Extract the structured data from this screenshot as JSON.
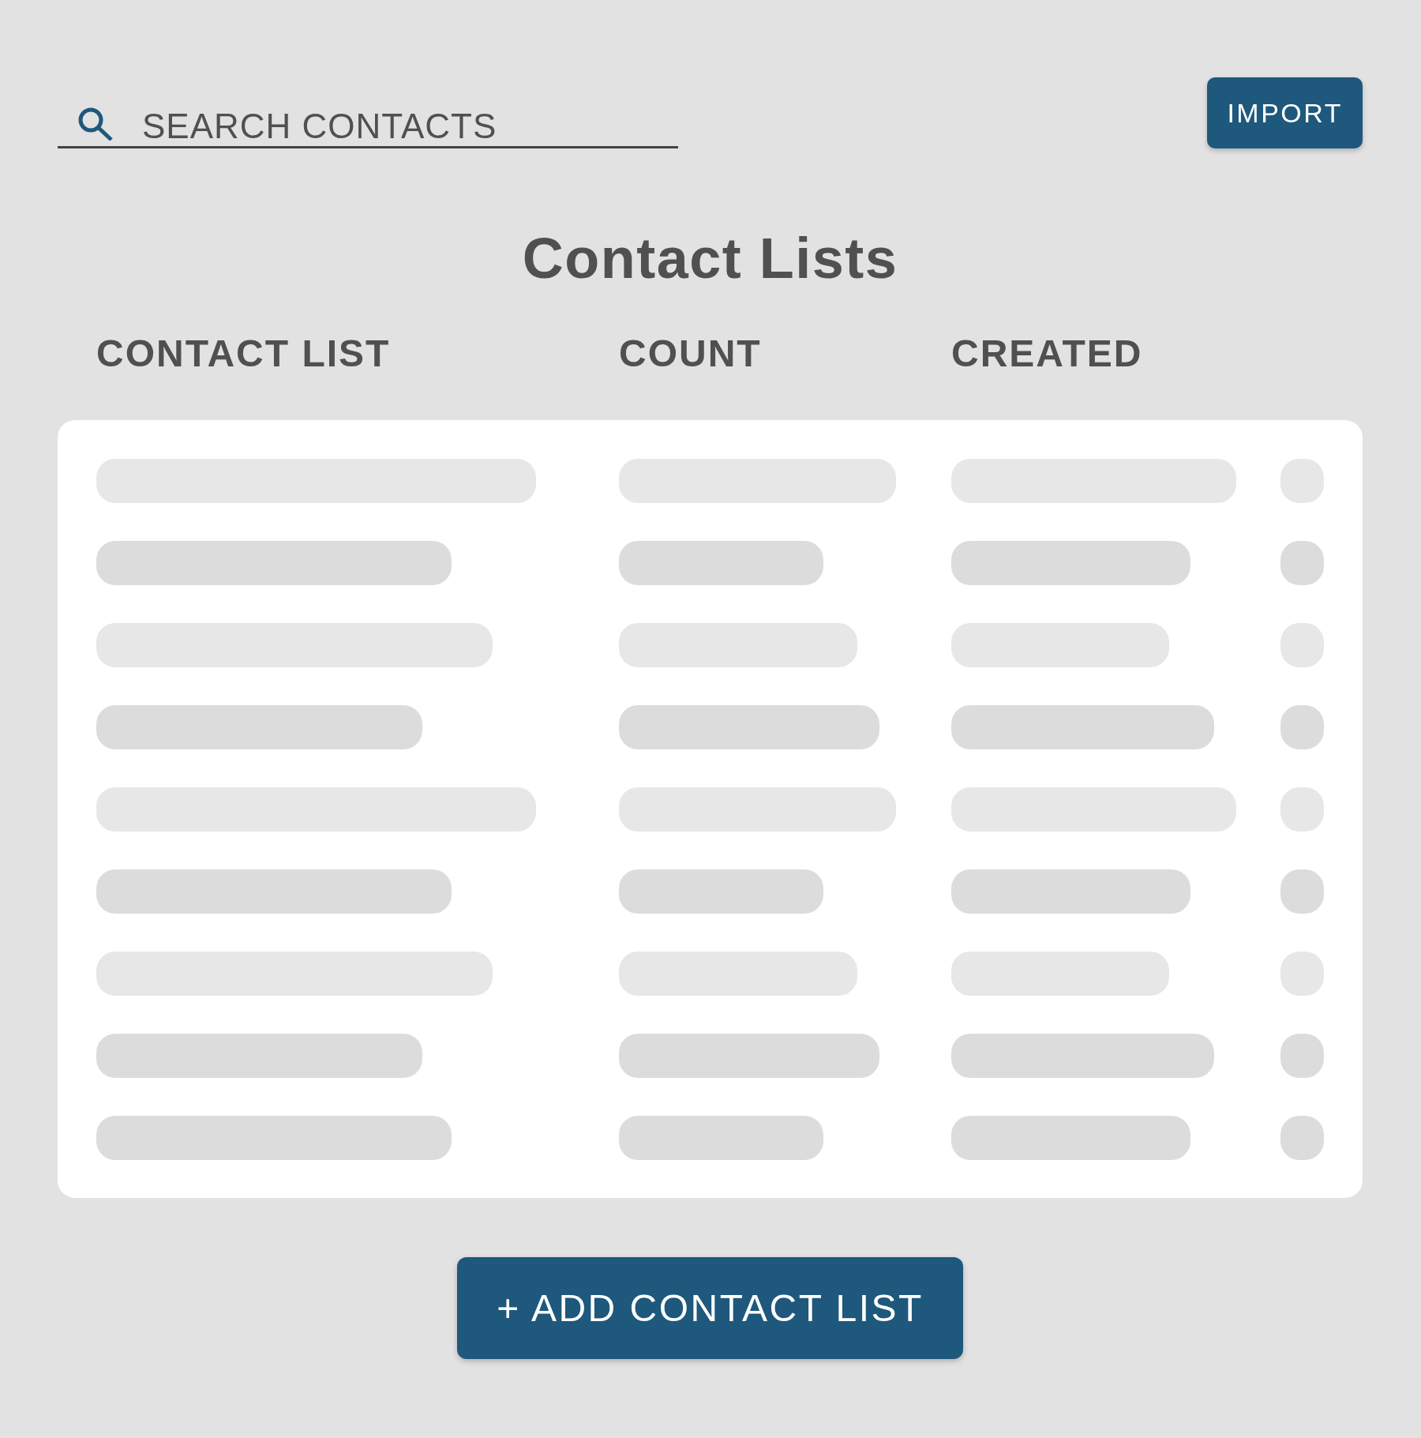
{
  "search": {
    "placeholder": "SEARCH CONTACTS"
  },
  "import_button": {
    "label": "IMPORT"
  },
  "title": "Contact Lists",
  "table": {
    "columns": [
      "CONTACT LIST",
      "COUNT",
      "CREATED"
    ],
    "rows": [
      {
        "kind": "light"
      },
      {
        "kind": "dark"
      },
      {
        "kind": "light"
      },
      {
        "kind": "dark"
      },
      {
        "kind": "light"
      },
      {
        "kind": "dark"
      },
      {
        "kind": "light"
      },
      {
        "kind": "dark"
      },
      {
        "kind": "dark"
      }
    ]
  },
  "add_button": {
    "label": "+ ADD CONTACT LIST"
  }
}
